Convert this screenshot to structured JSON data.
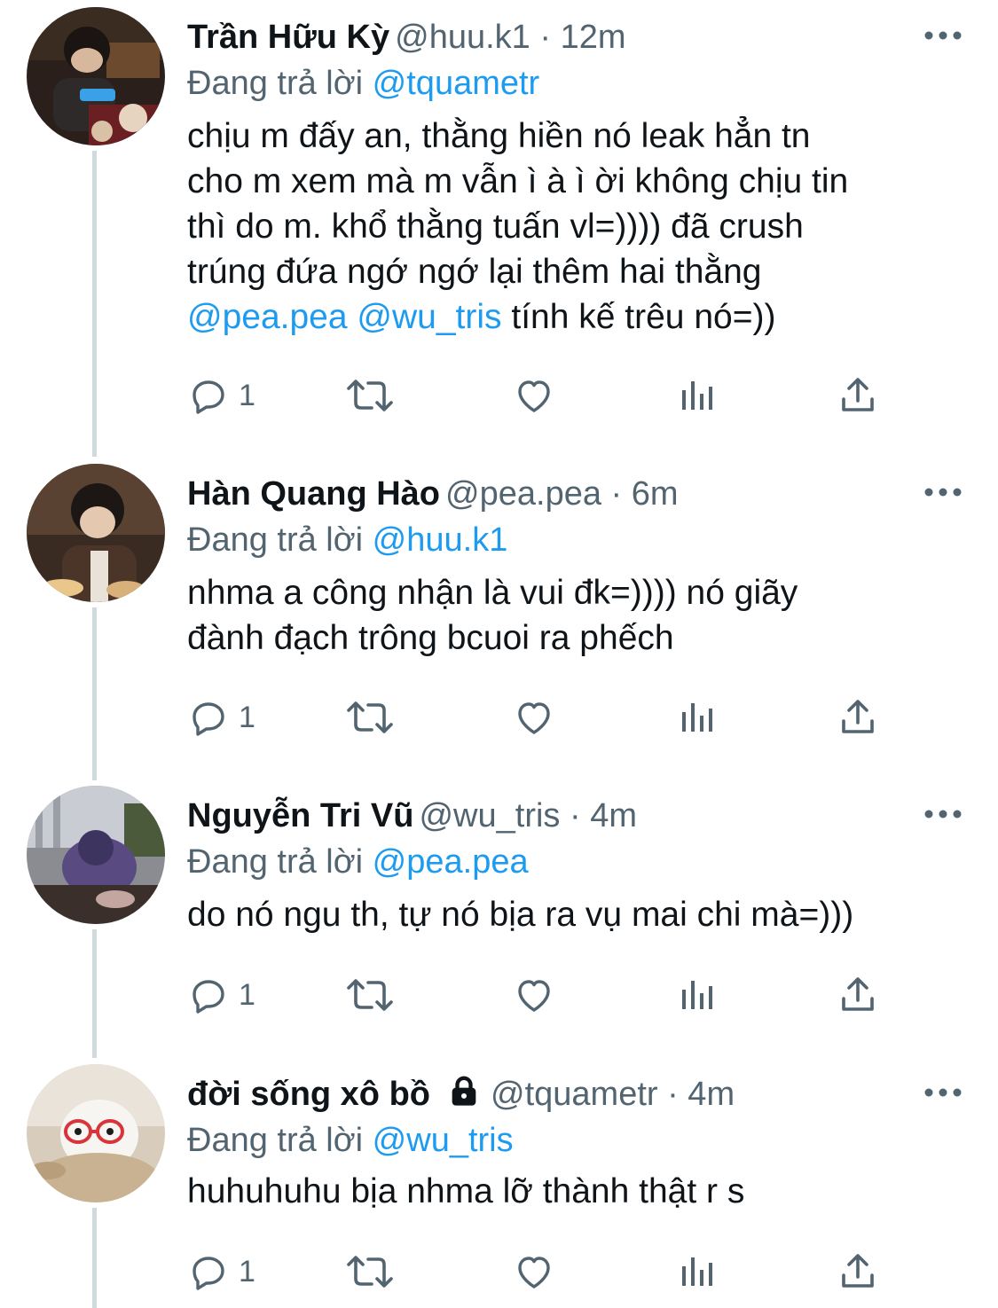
{
  "reply_prefix": "Đang trả lời",
  "tweets": [
    {
      "name": "Trần Hữu Kỳ",
      "meta": "@huu.k1 · 12m",
      "locked": false,
      "reply_to": "@tquametr",
      "text": "chịu m đấy an, thằng hiền nó leak hẳn tn\ncho m xem mà m vẫn ì à ì ời không chịu tin\nthì do m. khổ thằng tuấn vl=)))) đã crush\ntrúng đứa ngớ ngớ lại thêm hai thằng",
      "text_mention_1": "@pea.pea",
      "text_mention_2": "@wu_tris",
      "text_tail": " tính kế trêu nó=))",
      "reply_count": "1"
    },
    {
      "name": "Hàn Quang Hào",
      "meta": "@pea.pea · 6m",
      "locked": false,
      "reply_to": "@huu.k1",
      "text": "nhma a công nhận là vui đk=)))) nó giãy\nđành đạch trông bcuoi ra phếch",
      "reply_count": "1"
    },
    {
      "name": "Nguyễn Tri Vũ",
      "meta": "@wu_tris · 4m",
      "locked": false,
      "reply_to": "@pea.pea",
      "text": "do nó ngu th, tự nó bịa ra vụ mai chi mà=)))",
      "reply_count": "1"
    },
    {
      "name": "đời sống xô bồ",
      "meta": "@tquametr · 4m",
      "locked": true,
      "reply_to": "@wu_tris",
      "text": "huhuhuhu bịa nhma lỡ thành thật r s",
      "reply_count": "1"
    }
  ],
  "colors": {
    "accent": "#1d9bf0",
    "secondary_text": "#536471",
    "thread_line": "#cfd9de"
  }
}
